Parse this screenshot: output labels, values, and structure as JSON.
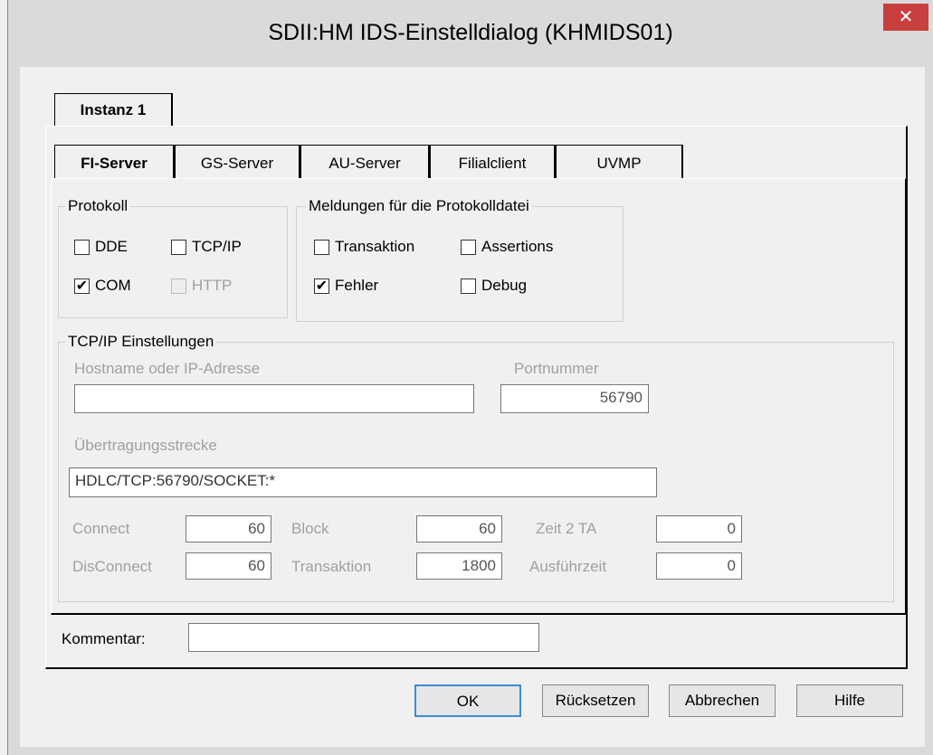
{
  "window": {
    "title": "SDII:HM IDS-Einstelldialog (KHMIDS01)",
    "close_glyph": "✕"
  },
  "outer_tab": "Instanz 1",
  "tabs": [
    "FI-Server",
    "GS-Server",
    "AU-Server",
    "Filialclient",
    "UVMP"
  ],
  "protokoll": {
    "label": "Protokoll",
    "dde": {
      "label": "DDE",
      "checked": false
    },
    "tcpip": {
      "label": "TCP/IP",
      "checked": false
    },
    "com": {
      "label": "COM",
      "checked": true
    },
    "http": {
      "label": "HTTP",
      "checked": false,
      "disabled": true
    }
  },
  "meldungen": {
    "label": "Meldungen für die Protokolldatei",
    "transaktion": {
      "label": "Transaktion",
      "checked": false
    },
    "assertions": {
      "label": "Assertions",
      "checked": false
    },
    "fehler": {
      "label": "Fehler",
      "checked": true
    },
    "debug": {
      "label": "Debug",
      "checked": false
    }
  },
  "tcpip": {
    "label": "TCP/IP Einstellungen",
    "hostname_label": "Hostname oder IP-Adresse",
    "hostname_value": "",
    "port_label": "Portnummer",
    "port_value": "56790",
    "strecke_label": "Übertragungsstrecke",
    "strecke_value": "HDLC/TCP:56790/SOCKET:*",
    "connect_label": "Connect",
    "connect_value": "60",
    "block_label": "Block",
    "block_value": "60",
    "zeit_label": "Zeit 2 TA",
    "zeit_value": "0",
    "disconnect_label": "DisConnect",
    "disconnect_value": "60",
    "transaktion_label": "Transaktion",
    "transaktion_value": "1800",
    "ausfuehr_label": "Ausführzeit",
    "ausfuehr_value": "0"
  },
  "kommentar": {
    "label": "Kommentar:",
    "value": ""
  },
  "buttons": {
    "ok": "OK",
    "reset": "Rücksetzen",
    "cancel": "Abbrechen",
    "help": "Hilfe"
  },
  "colors": {
    "close": "#c8403d",
    "default_button_border": "#3b8be0"
  }
}
